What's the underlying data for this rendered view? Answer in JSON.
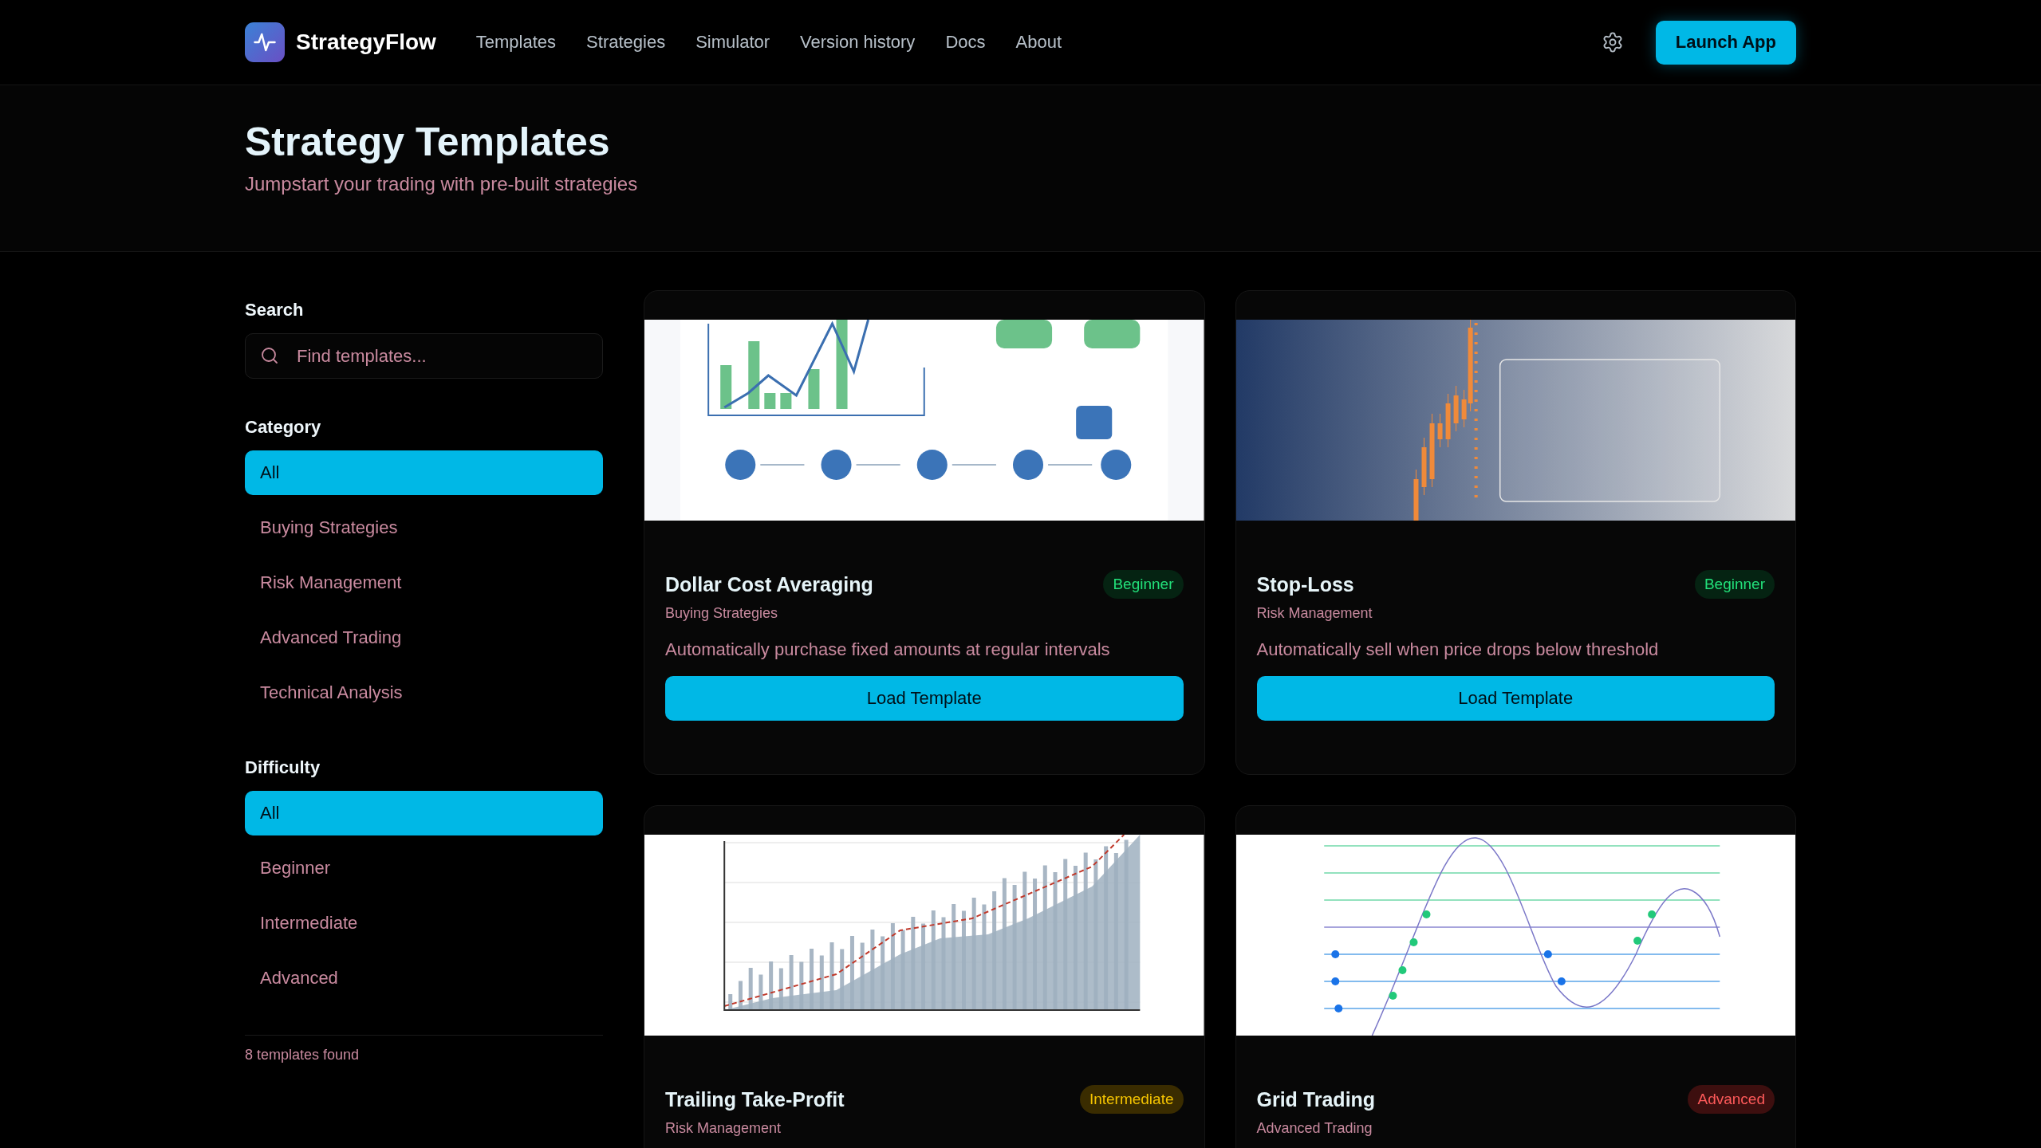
{
  "header": {
    "brand": "StrategyFlow",
    "nav": [
      {
        "label": "Templates"
      },
      {
        "label": "Strategies"
      },
      {
        "label": "Simulator"
      },
      {
        "label": "Version history"
      },
      {
        "label": "Docs"
      },
      {
        "label": "About"
      }
    ],
    "cta": "Launch App"
  },
  "hero": {
    "title": "Strategy Templates",
    "subtitle": "Jumpstart your trading with pre-built strategies"
  },
  "sidebar": {
    "search": {
      "label": "Search",
      "placeholder": "Find templates..."
    },
    "filters": [
      {
        "title": "Category",
        "options": [
          {
            "label": "All",
            "selected": true
          },
          {
            "label": "Buying Strategies",
            "selected": false
          },
          {
            "label": "Risk Management",
            "selected": false
          },
          {
            "label": "Advanced Trading",
            "selected": false
          },
          {
            "label": "Technical Analysis",
            "selected": false
          }
        ]
      },
      {
        "title": "Difficulty",
        "options": [
          {
            "label": "All",
            "selected": true
          },
          {
            "label": "Beginner",
            "selected": false
          },
          {
            "label": "Intermediate",
            "selected": false
          },
          {
            "label": "Advanced",
            "selected": false
          }
        ]
      }
    ],
    "result_count": "8 templates found"
  },
  "templates": [
    {
      "kind": "flow",
      "title": "Dollar Cost Averaging",
      "badge": {
        "text": "Beginner",
        "kind": "beginner"
      },
      "category": "Buying Strategies",
      "description": "Automatically purchase fixed amounts at regular intervals",
      "button": "Load Template"
    },
    {
      "kind": "candles",
      "title": "Stop-Loss",
      "badge": {
        "text": "Beginner",
        "kind": "beginner"
      },
      "category": "Risk Management",
      "description": "Automatically sell when price drops below threshold",
      "button": "Load Template"
    },
    {
      "kind": "area",
      "title": "Trailing Take-Profit",
      "badge": {
        "text": "Intermediate",
        "kind": "intermediate"
      },
      "category": "Risk Management"
    },
    {
      "kind": "grid",
      "title": "Grid Trading",
      "badge": {
        "text": "Advanced",
        "kind": "advanced"
      },
      "category": "Advanced Trading"
    }
  ]
}
